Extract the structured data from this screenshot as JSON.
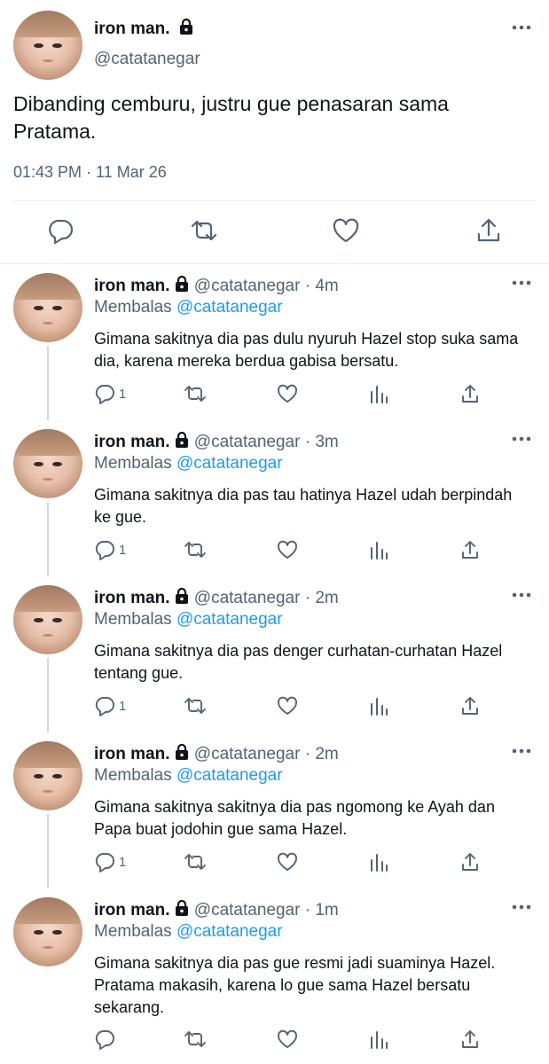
{
  "main_tweet": {
    "display_name": "iron man.",
    "handle": "@catatanegar",
    "text": "Dibanding cemburu, justru gue penasaran sama Pratama.",
    "timestamp": "01:43 PM · 11 Mar 26",
    "icons": [
      "reply-icon",
      "retweet-icon",
      "like-icon",
      "share-icon"
    ]
  },
  "replies": [
    {
      "display_name": "iron man.",
      "handle_time": "@catatanegar · 4m",
      "replying_label": "Membalas",
      "replying_to": "@catatanegar",
      "text": "Gimana sakitnya dia pas dulu nyuruh Hazel stop suka sama dia, karena mereka berdua gabisa bersatu.",
      "reply_count": "1"
    },
    {
      "display_name": "iron man.",
      "handle_time": "@catatanegar · 3m",
      "replying_label": "Membalas",
      "replying_to": "@catatanegar",
      "text": "Gimana sakitnya dia pas tau hatinya Hazel udah berpindah ke gue.",
      "reply_count": "1"
    },
    {
      "display_name": "iron man.",
      "handle_time": "@catatanegar · 2m",
      "replying_label": "Membalas",
      "replying_to": "@catatanegar",
      "text": "Gimana sakitnya dia pas denger curhatan-curhatan Hazel tentang gue.",
      "reply_count": "1"
    },
    {
      "display_name": "iron man.",
      "handle_time": "@catatanegar · 2m",
      "replying_label": "Membalas",
      "replying_to": "@catatanegar",
      "text": "Gimana sakitnya sakitnya dia pas ngomong ke Ayah dan Papa buat jodohin gue sama Hazel.",
      "reply_count": "1"
    },
    {
      "display_name": "iron man.",
      "handle_time": "@catatanegar · 1m",
      "replying_label": "Membalas",
      "replying_to": "@catatanegar",
      "text": "Gimana sakitnya dia pas gue resmi jadi suaminya Hazel. Pratama makasih, karena lo gue sama Hazel bersatu sekarang.",
      "reply_count": ""
    }
  ],
  "colors": {
    "link": "#1d9bf0",
    "muted": "#536471",
    "text": "#0f1419",
    "divider": "#e6ecf0"
  }
}
